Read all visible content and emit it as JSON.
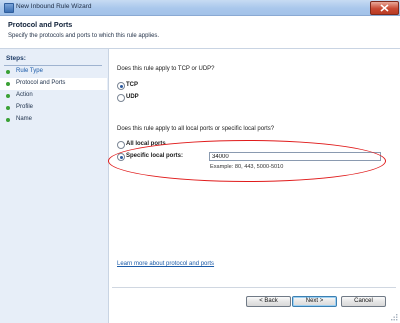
{
  "window": {
    "title": "New Inbound Rule Wizard"
  },
  "header": {
    "title": "Protocol and Ports",
    "subtitle": "Specify the protocols and ports to which this rule applies."
  },
  "steps": {
    "title": "Steps:",
    "items": [
      {
        "label": "Rule Type"
      },
      {
        "label": "Protocol and Ports"
      },
      {
        "label": "Action"
      },
      {
        "label": "Profile"
      },
      {
        "label": "Name"
      }
    ]
  },
  "protocol": {
    "question": "Does this rule apply to TCP or UDP?",
    "options": [
      {
        "label": "TCP",
        "selected": true
      },
      {
        "label": "UDP",
        "selected": false
      }
    ]
  },
  "ports": {
    "question": "Does this rule apply to all local ports or specific local ports?",
    "all_label": "All local ports",
    "specific_label": "Specific local ports:",
    "value": "34000",
    "example": "Example: 80, 443, 5000-5010"
  },
  "learn_more": "Learn more about protocol and ports",
  "buttons": {
    "back": "< Back",
    "next": "Next >",
    "cancel": "Cancel"
  },
  "colors": {
    "highlight": "#e01b1b",
    "step_dot": "#3aa135",
    "link": "#1a5aa8"
  }
}
